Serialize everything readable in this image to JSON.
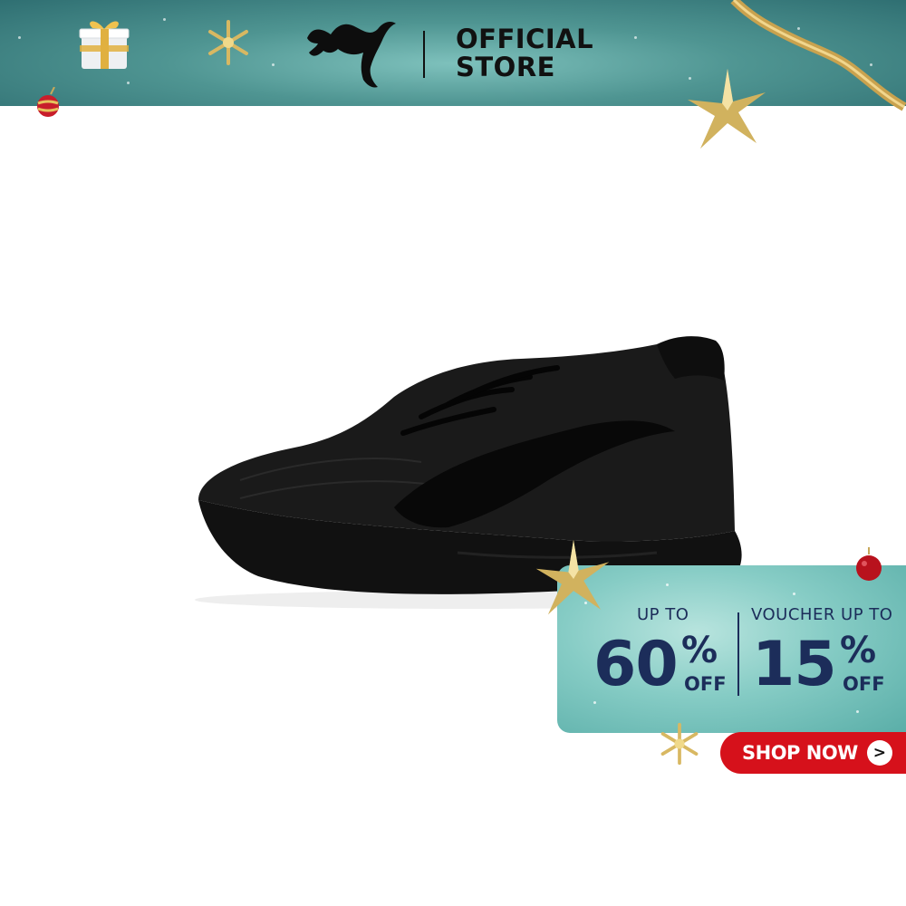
{
  "header": {
    "brand_logo_text": "PUMA",
    "store_line1": "OFFICIAL",
    "store_line2": "STORE"
  },
  "product": {
    "image_icon": "black-running-shoe"
  },
  "promo": {
    "left_label": "UP TO",
    "left_value": "60",
    "right_label": "VOUCHER UP TO",
    "right_value": "15",
    "percent_sign": "%",
    "off_text": "OFF"
  },
  "cta": {
    "label": "SHOP NOW",
    "arrow": ">"
  },
  "colors": {
    "banner_teal": "#4f9592",
    "promo_teal": "#86ccc5",
    "text_navy": "#1c2d5a",
    "cta_red": "#d6111b",
    "gold": "#c8a85a"
  }
}
